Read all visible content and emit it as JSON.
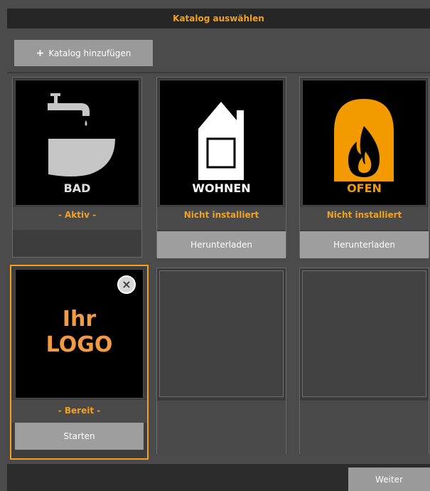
{
  "header": {
    "title": "Katalog auswählen"
  },
  "toolbar": {
    "add_label": "Katalog hinzufügen",
    "add_icon": "plus-icon"
  },
  "catalogs": [
    {
      "image_label": "BAD",
      "status": "- Aktiv -",
      "action": ""
    },
    {
      "image_label": "WOHNEN",
      "status": "Nicht installiert",
      "action": "Herunterladen"
    },
    {
      "image_label": "OFEN",
      "status": "Nicht installiert",
      "action": "Herunterladen"
    },
    {
      "logo_line1": "Ihr",
      "logo_line2": "LOGO",
      "status": "- Bereit -",
      "action": "Starten",
      "close_icon": "close-icon"
    }
  ],
  "footer": {
    "next_label": "Weiter"
  },
  "colors": {
    "accent": "#f3a11c",
    "button": "#9e9e9e",
    "background": "#4b4b4b"
  }
}
